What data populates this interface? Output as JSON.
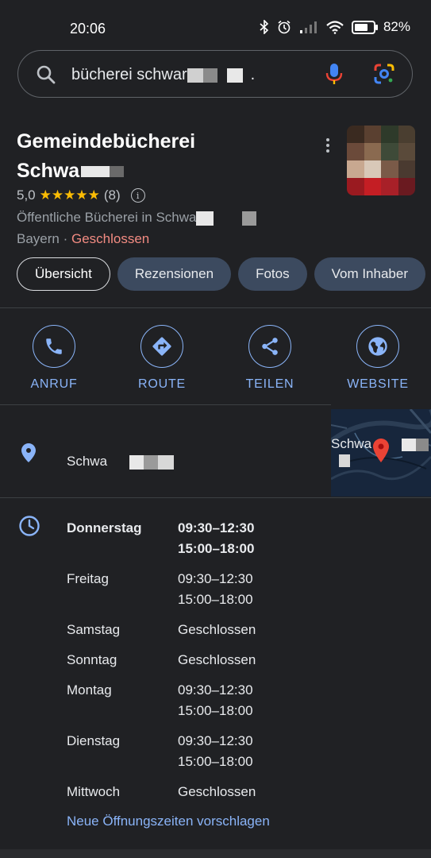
{
  "status_bar": {
    "time": "20:06",
    "battery": "82%",
    "battery_level": 0.82
  },
  "search": {
    "query": "bücherei schwar",
    "query_suffix": "."
  },
  "place": {
    "title_line1": "Gemeindebücherei",
    "title_line2": "Schwa",
    "rating": "5,0",
    "stars": "★★★★★",
    "review_count": "(8)",
    "category": "Öffentliche Bücherei in Schwa",
    "region": "Bayern",
    "separator": " · ",
    "status": "Geschlossen"
  },
  "tabs": [
    {
      "label": "Übersicht",
      "active": true
    },
    {
      "label": "Rezensionen",
      "active": false
    },
    {
      "label": "Fotos",
      "active": false
    },
    {
      "label": "Vom Inhaber",
      "active": false
    }
  ],
  "actions": {
    "call": "ANRUF",
    "route": "ROUTE",
    "share": "TEILEN",
    "website": "WEBSITE"
  },
  "address": {
    "text": "Schwa",
    "map_label": "Schwa"
  },
  "hours": [
    {
      "day": "Donnerstag",
      "times": [
        "09:30–12:30",
        "15:00–18:00"
      ]
    },
    {
      "day": "Freitag",
      "times": [
        "09:30–12:30",
        "15:00–18:00"
      ]
    },
    {
      "day": "Samstag",
      "times": [
        "Geschlossen"
      ]
    },
    {
      "day": "Sonntag",
      "times": [
        "Geschlossen"
      ]
    },
    {
      "day": "Montag",
      "times": [
        "09:30–12:30",
        "15:00–18:00"
      ]
    },
    {
      "day": "Dienstag",
      "times": [
        "09:30–12:30",
        "15:00–18:00"
      ]
    },
    {
      "day": "Mittwoch",
      "times": [
        "Geschlossen"
      ]
    }
  ],
  "suggest_hours": "Neue Öffnungszeiten vorschlagen",
  "colors": {
    "background": "#202124",
    "accent": "#8ab4f8",
    "closed": "#f28b82",
    "star": "#fbbc04"
  }
}
